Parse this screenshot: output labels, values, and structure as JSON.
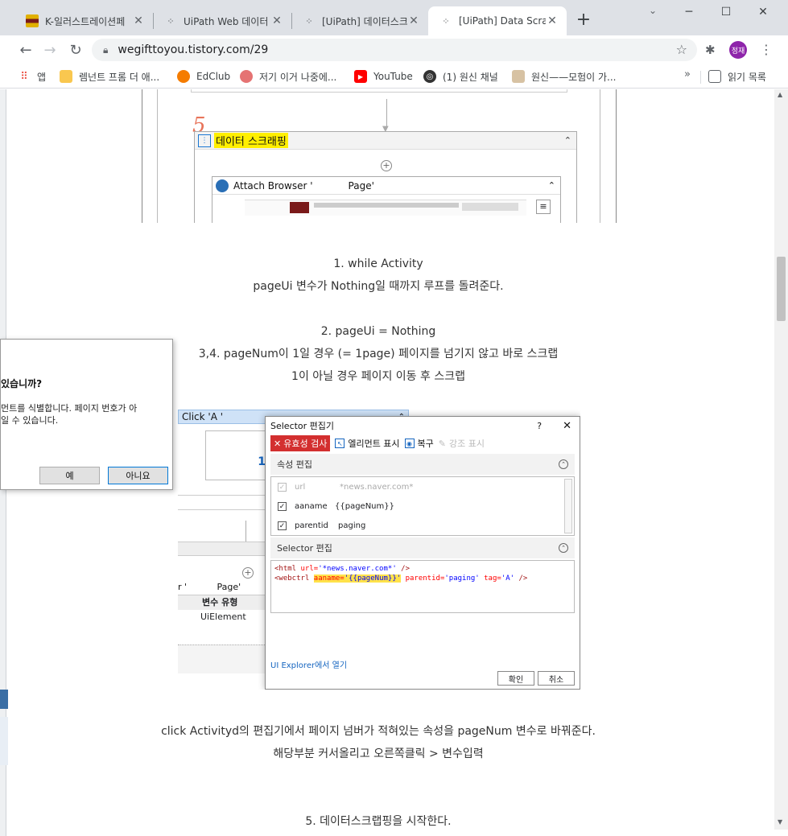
{
  "browser": {
    "tabs": [
      {
        "title": "K-일러스트레이션페",
        "active": false
      },
      {
        "title": "UiPath Web 데이터",
        "active": false
      },
      {
        "title": "[UiPath] 데이터스크",
        "active": false
      },
      {
        "title": "[UiPath] Data Scrap",
        "active": true
      }
    ],
    "new_tab": "+",
    "window_controls": {
      "minimize": "─",
      "maximize": "☐",
      "close": "✕",
      "tab_search": "⌄"
    },
    "url": "wegifttoyou.tistory.com/29",
    "profile_initials": "정재",
    "bookmarks": [
      {
        "label": "앱",
        "icon": "apps-grid-icon"
      },
      {
        "label": "렘넌트 프롬 더 애...",
        "icon": "bookmark-icon"
      },
      {
        "label": "EdClub",
        "icon": "edclub-icon"
      },
      {
        "label": "저기 이거 나중에...",
        "icon": "bookmark-icon"
      },
      {
        "label": "YouTube",
        "icon": "youtube-icon"
      },
      {
        "label": "(1) 원신 채널",
        "icon": "channel-icon"
      },
      {
        "label": "원신——모험이 가...",
        "icon": "genshin-icon"
      }
    ],
    "bookmarks_more": "»",
    "reading_list": "읽기 목록"
  },
  "article": {
    "shot1": {
      "annotation_number": "5",
      "sequence_title": "데이터 스크래핑",
      "attach_title": "Attach Browser '",
      "attach_page": "Page'",
      "collapse": "⌃"
    },
    "text_block_1": [
      "1. while Activity",
      "pageUi 변수가 Nothing일 때까지 루프를 돌려준다.",
      "",
      "2. pageUi = Nothing",
      "3,4. pageNum이 1일 경우 (= 1page) 페이지를 넘기지 않고 바로 스크랩",
      "1이 아닐 경우 페이지 이동 후 스크랩"
    ],
    "dialog": {
      "question": "있습니까?",
      "body_line1": "먼트를 식별합니다. 페이지 번호가 아",
      "body_line2": "일 수 있습니다.",
      "yes": "예",
      "no": "아니요"
    },
    "shot2": {
      "click_title": "Click 'A '",
      "back_number": "1",
      "back_header_left": "r '",
      "back_header_page": "Page'",
      "var_type_header": "변수 유형",
      "var_type_value": "UiElement",
      "selector": {
        "title": "Selector 편집기",
        "help": "?",
        "close": "✕",
        "validate": "유효성 검사",
        "show_element": "엘리먼트 표시",
        "restore": "복구",
        "highlight": "강조 표시",
        "attr_section": "속성 편집",
        "attributes": [
          {
            "name": "url",
            "value": "*news.naver.com*",
            "checked": true,
            "disabled": true
          },
          {
            "name": "aaname",
            "value": "{{pageNum}}",
            "checked": true,
            "disabled": false
          },
          {
            "name": "parentid",
            "value": "paging",
            "checked": true,
            "disabled": false
          }
        ],
        "selector_section": "Selector 편집",
        "code_line1": {
          "tag_open": "<html ",
          "attr": "url=",
          "val": "'*news.naver.com*'",
          "close": " />"
        },
        "code_line2": {
          "tag_open": "<webctrl ",
          "hl_attr": "aaname=",
          "hl_val": "'{{pageNum}}'",
          "rest_attr1": " parentid=",
          "rest_val1": "'paging'",
          "rest_attr2": " tag=",
          "rest_val2": "'A'",
          "close": " />"
        },
        "ui_explorer": "UI Explorer에서 열기",
        "ok": "확인",
        "cancel": "취소"
      }
    },
    "text_block_2": [
      "click Activityd의 편집기에서 페이지 넘버가 적혀있는 속성을 pageNum 변수로 바꿔준다.",
      "해당부분 커서올리고 오른쪽클릭 > 변수입력"
    ],
    "text_block_3": "5. 데이터스크랩핑을 시작한다."
  },
  "colors": {
    "tabstrip": "#dee1e6",
    "highlight": "#ffef00",
    "validate_red": "#d32f2f",
    "profile_purple": "#8e24aa"
  }
}
